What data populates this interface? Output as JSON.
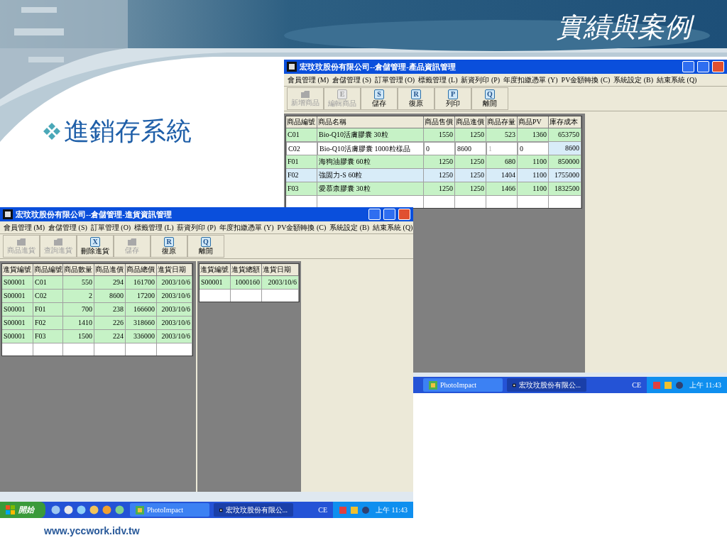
{
  "slide": {
    "title": "實績與案例",
    "bullet": "進銷存系統",
    "footer": "www.yccwork.idv.tw"
  },
  "screens": [
    {
      "title": "宏玟玟股份有限公司--倉儲管理-產品資訊管理",
      "menu": [
        "會員管理 (M)",
        "倉儲管理 (S)",
        "訂單管理 (O)",
        "標籤管理 (L)",
        "新資列印 (P)",
        "年度扣繳憑單 (Y)",
        "PV金額轉換 (C)",
        "系統設定 (B)",
        "結束系統 (Q)"
      ],
      "toolbar": [
        {
          "label": "新增商品",
          "disabled": true
        },
        {
          "label": "編輯商品",
          "key": "E",
          "disabled": true
        },
        {
          "label": "儲存",
          "key": "S",
          "disabled": false
        },
        {
          "label": "復原",
          "key": "R",
          "disabled": false
        },
        {
          "label": "列印",
          "key": "P",
          "disabled": false
        },
        {
          "label": "離開",
          "key": "Q",
          "disabled": false
        }
      ],
      "grids": [
        {
          "columns": [
            "商品編號",
            "商品名稱",
            "商品售價",
            "商品進價",
            "商品存量",
            "商品PV",
            "庫存成本"
          ],
          "rows": [
            {
              "cells": [
                "C01",
                "Bio-Q10活膚膠囊 30粒",
                "1550",
                "1250",
                "523",
                "1360",
                "653750"
              ],
              "selected": false,
              "editing": false
            },
            {
              "cells": [
                "C02",
                "Bio-Q10活膚膠囊 1000粒樣品",
                "0",
                "8600",
                "1",
                "0",
                "8600"
              ],
              "selected": false,
              "editing": true,
              "locked": [
                false,
                false,
                false,
                false,
                true,
                false,
                false
              ]
            },
            {
              "cells": [
                "F01",
                "海狗油膠囊 60粒",
                "1250",
                "1250",
                "680",
                "1100",
                "850000"
              ],
              "selected": false,
              "editing": false
            },
            {
              "cells": [
                "F02",
                "強固力-S 60粒",
                "1250",
                "1250",
                "1404",
                "1100",
                "1755000"
              ],
              "selected": true,
              "editing": false
            },
            {
              "cells": [
                "F03",
                "愛慕柰膠囊 30粒",
                "1250",
                "1250",
                "1466",
                "1100",
                "1832500"
              ],
              "selected": false,
              "editing": false
            }
          ]
        }
      ],
      "taskbar": {
        "tasks": [
          {
            "label": "PhotoImpact",
            "selected": false
          },
          {
            "label": "宏玟玟股份有限公...",
            "selected": true
          }
        ],
        "language": "CE",
        "clock": "上午 11:43"
      }
    },
    {
      "title": "宏玟玟股份有限公司--倉儲管理-進貨資訊管理",
      "menu": [
        "會員管理 (M)",
        "倉儲管理 (S)",
        "訂單管理 (O)",
        "標籤管理 (L)",
        "薪資列印 (P)",
        "年度扣繳憑單 (Y)",
        "PV金額轉換 (C)",
        "系統設定 (B)",
        "結束系統 (Q)"
      ],
      "toolbar": [
        {
          "label": "商品進貨",
          "disabled": true
        },
        {
          "label": "查詢進貨",
          "disabled": true
        },
        {
          "label": "刪除進貨",
          "key": "X",
          "disabled": false
        },
        {
          "label": "儲存",
          "disabled": true
        },
        {
          "label": "復原",
          "key": "R",
          "disabled": false
        },
        {
          "label": "離開",
          "key": "Q",
          "disabled": false
        }
      ],
      "grids": [
        {
          "columns": [
            "進貨編號",
            "商品編號",
            "商品數量",
            "商品進價",
            "商品總價",
            "進貨日期"
          ],
          "rows": [
            {
              "cells": [
                "S00001",
                "C01",
                "550",
                "294",
                "161700",
                "2003/10/6"
              ],
              "selected": false,
              "editing": false
            },
            {
              "cells": [
                "S00001",
                "C02",
                "2",
                "8600",
                "17200",
                "2003/10/6"
              ],
              "selected": false,
              "editing": false
            },
            {
              "cells": [
                "S00001",
                "F01",
                "700",
                "238",
                "166600",
                "2003/10/6"
              ],
              "selected": false,
              "editing": false
            },
            {
              "cells": [
                "S00001",
                "F02",
                "1410",
                "226",
                "318660",
                "2003/10/6"
              ],
              "selected": false,
              "editing": false
            },
            {
              "cells": [
                "S00001",
                "F03",
                "1500",
                "224",
                "336000",
                "2003/10/6"
              ],
              "selected": false,
              "editing": false
            }
          ]
        },
        {
          "columns": [
            "進貨編號",
            "進貨總額",
            "進貨日期"
          ],
          "rows": [
            {
              "cells": [
                "S00001",
                "1000160",
                "2003/10/6"
              ],
              "selected": false,
              "editing": false
            }
          ]
        }
      ],
      "taskbar": {
        "start": "開始",
        "tasks": [
          {
            "label": "PhotoImpact",
            "selected": false
          },
          {
            "label": "宏玟玟股份有限公...",
            "selected": true
          }
        ],
        "language": "CE",
        "clock": "上午 11:43"
      }
    }
  ]
}
